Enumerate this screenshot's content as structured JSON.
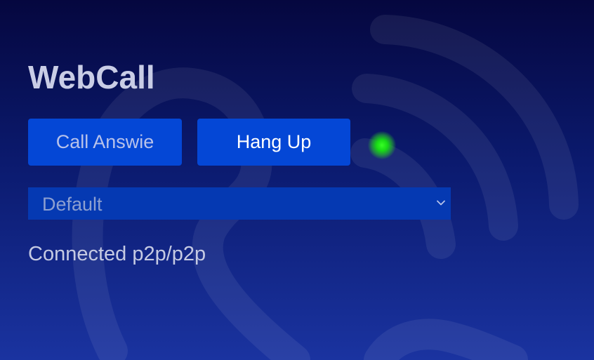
{
  "app": {
    "title": "WebCall"
  },
  "controls": {
    "answer_label": "Call Answie",
    "hangup_label": "Hang Up",
    "status_indicator": {
      "icon": "green-status-dot",
      "color": "#2eea1e"
    }
  },
  "device_select": {
    "value": "Default",
    "icon": "chevron-down-icon"
  },
  "status": {
    "text": "Connected p2p/p2p"
  },
  "theme": {
    "button_bg": "#0447d6",
    "select_bg": "#0539b2",
    "bg_top": "#05073f",
    "bg_bottom": "#1a33a0"
  }
}
